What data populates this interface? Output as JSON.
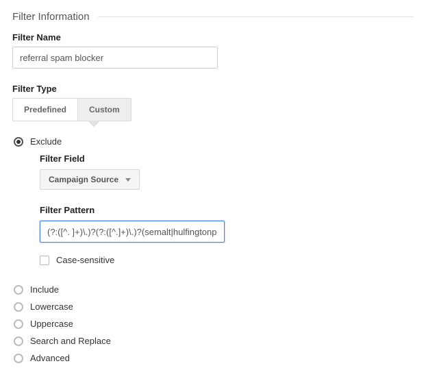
{
  "section_title": "Filter Information",
  "filter_name": {
    "label": "Filter Name",
    "value": "referral spam blocker"
  },
  "filter_type": {
    "label": "Filter Type",
    "tabs": {
      "predefined": "Predefined",
      "custom": "Custom",
      "active": "custom"
    }
  },
  "custom": {
    "options": {
      "exclude": "Exclude",
      "include": "Include",
      "lowercase": "Lowercase",
      "uppercase": "Uppercase",
      "search_replace": "Search and Replace",
      "advanced": "Advanced"
    },
    "selected": "exclude",
    "exclude_block": {
      "filter_field_label": "Filter Field",
      "filter_field_value": "Campaign Source",
      "filter_pattern_label": "Filter Pattern",
      "filter_pattern_value": "(?:([^. ]+)\\.)?(?:([^.]+)\\.)?(semalt|hulfingtonpos",
      "case_sensitive_label": "Case-sensitive",
      "case_sensitive_checked": false
    }
  }
}
